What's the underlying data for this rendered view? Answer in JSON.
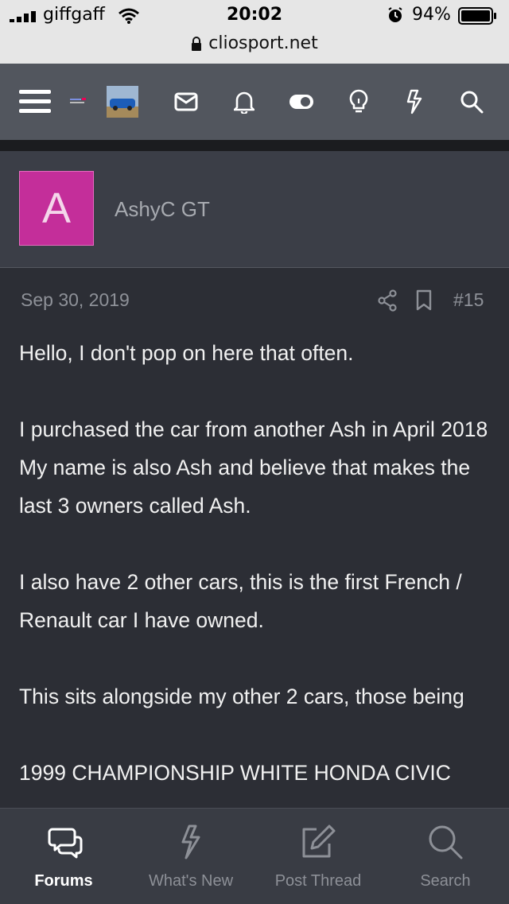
{
  "status_bar": {
    "carrier": "giffgaff",
    "time": "20:02",
    "battery": "94%"
  },
  "browser": {
    "url": "cliosport.net"
  },
  "nav_icons": [
    "menu-icon",
    "site-logo",
    "user-avatar-thumb",
    "mail-icon",
    "bell-icon",
    "toggle-icon",
    "lightbulb-icon",
    "bolt-icon",
    "search-icon"
  ],
  "post": {
    "author_initial": "A",
    "author_name": "AshyC GT",
    "date": "Sep 30, 2019",
    "number": "#15",
    "paragraphs": [
      "Hello, I don't pop on here that often.",
      "I purchased the car from another Ash in April 2018 My name is also Ash and believe that makes the last 3 owners called Ash.",
      "I also have 2 other cars, this is the first French / Renault car I have owned.",
      "This sits alongside my other 2 cars, those being",
      "1999 CHAMPIONSHIP WHITE HONDA CIVIC"
    ]
  },
  "bottom_nav": {
    "forums": "Forums",
    "whats_new": "What's New",
    "post_thread": "Post Thread",
    "search": "Search"
  },
  "colors": {
    "avatar_bg": "#c42e9a",
    "nav_bg": "#52565e",
    "body_bg": "#2c2e35"
  }
}
